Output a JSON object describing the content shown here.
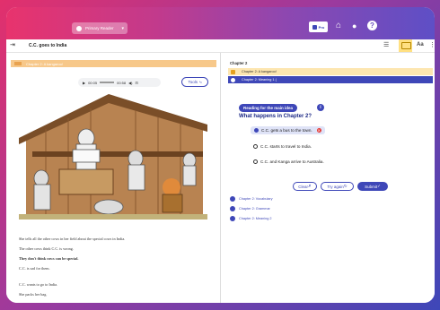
{
  "header": {
    "user_selector": "Primary Reader",
    "prefs_label": "Pro"
  },
  "subbar": {
    "title": "C.C. goes to India",
    "font_button": "Aa"
  },
  "left": {
    "chapter_band": "Chapter 2: A kangaroo!",
    "audio": {
      "elapsed": "00:05",
      "duration": "00:58"
    },
    "tools_label": "Tools",
    "story": [
      "She tells all the other cows in her field about the special cows in India.",
      "The other cows think C.C. is wrong.",
      "They don't think cows can be special.",
      "C.C. is sad for them.",
      "C.C. wants to go to India.",
      "She packs her bag."
    ]
  },
  "right": {
    "chapter_title": "Chapter 2",
    "open_section": "Chapter 2: A kangaroo!",
    "current_item": "Chapter 2: Meaning 1 (",
    "pill": "Reading for the main idea",
    "info": "i",
    "question": "What happens in Chapter 2?",
    "options": [
      "C.C. gets a bus to the town.",
      "C.C. starts to travel to India.",
      "C.C. and Kanga arrive to Australia."
    ],
    "buttons": {
      "clear": "Clear",
      "try_again": "Try again",
      "submit": "Submit"
    },
    "collapsed": [
      "Chapter 2: Vocabulary",
      "Chapter 2: Grammar",
      "Chapter 2: Meaning 2"
    ]
  }
}
